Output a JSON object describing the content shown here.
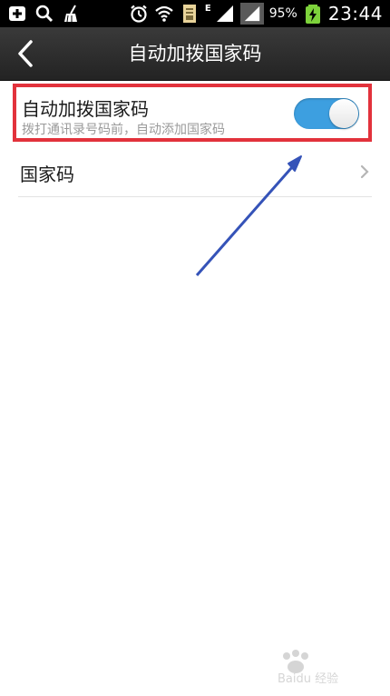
{
  "status_bar": {
    "battery_percent": "95%",
    "time": "23:44",
    "network_label": "E",
    "icons": [
      "add-box-icon",
      "search-icon",
      "broom-icon",
      "alarm-icon",
      "wifi-icon",
      "document-icon",
      "signal-icon",
      "signal-icon",
      "battery-charging-icon"
    ]
  },
  "header": {
    "title": "自动加拨国家码",
    "back_icon": "back-chevron-icon"
  },
  "settings": {
    "auto_country_code": {
      "title": "自动加拨国家码",
      "subtitle": "拨打通讯录号码前，自动添加国家码",
      "enabled": true
    },
    "country_code": {
      "label": "国家码"
    }
  },
  "annotation": {
    "highlight_color": "#e2323c",
    "arrow_color": "#3553b8"
  },
  "colors": {
    "toggle_on": "#3d9fe0",
    "title_bar": "#2e2e2e"
  },
  "watermark": {
    "text": "Baidu 经验"
  }
}
